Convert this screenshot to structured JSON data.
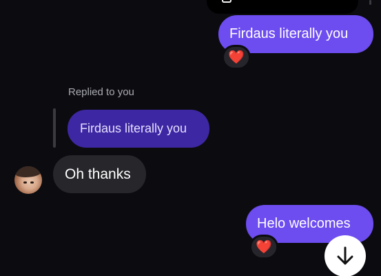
{
  "chat": {
    "messages": [
      {
        "direction": "outgoing",
        "text": "Firdaus literally you",
        "reaction": "❤️"
      },
      {
        "direction": "incoming",
        "reply_label": "Replied to you",
        "quoted_text": "Firdaus literally you",
        "text": "Oh thanks"
      },
      {
        "direction": "outgoing",
        "text": "Helo welcomes",
        "reaction": "❤️"
      }
    ]
  },
  "colors": {
    "background": "#0c0c10",
    "outgoing_bubble": "#6d4cf0",
    "quoted_bubble": "#3e27a3",
    "incoming_bubble": "#26262b",
    "reaction_heart": "#e8213a"
  },
  "icons": {
    "scroll_down": "arrow-down-icon",
    "reaction": "heart-icon"
  }
}
